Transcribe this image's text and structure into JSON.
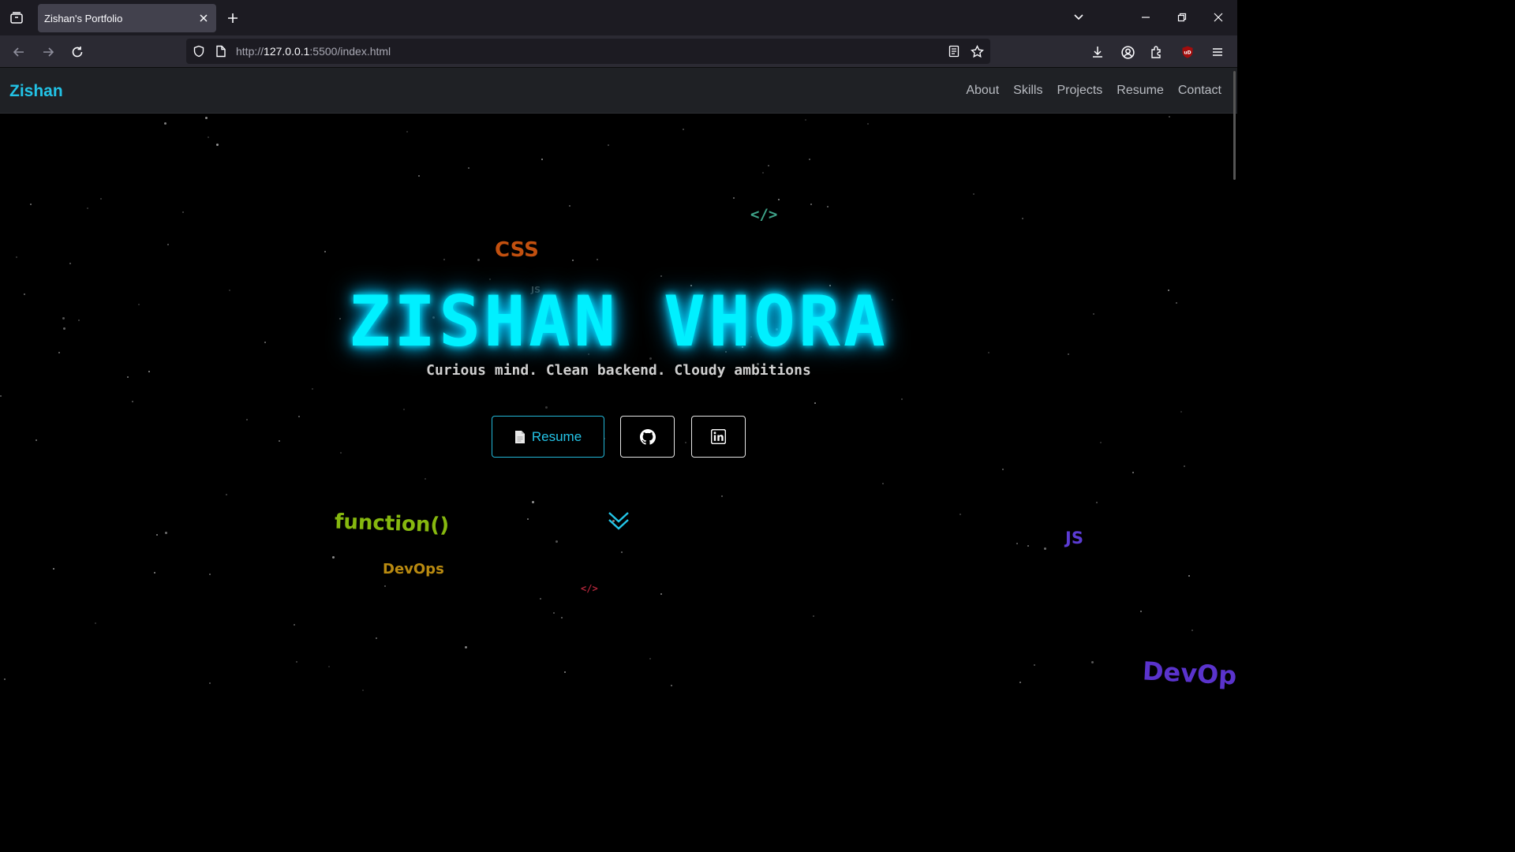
{
  "browser": {
    "tab_title": "Zishan's Portfolio",
    "url_prefix": "http://",
    "url_host": "127.0.0.1",
    "url_rest": ":5500/index.html"
  },
  "site": {
    "brand": "Zishan",
    "nav": [
      "About",
      "Skills",
      "Projects",
      "Resume",
      "Contact"
    ],
    "hero_title": "ZISHAN VHORA",
    "tagline": "Curious mind. Clean backend. Cloudy ambitions",
    "resume_button": "Resume",
    "floating_tags": [
      {
        "text": "</>",
        "color": "#3fa58b"
      },
      {
        "text": "CSS",
        "color": "#c2500f"
      },
      {
        "text": "JS",
        "color": "#3a3a3a"
      },
      {
        "text": "function()",
        "color": "#86b80f"
      },
      {
        "text": "DevOps",
        "color": "#b98a10"
      },
      {
        "text": "</>",
        "color": "#b0263a"
      },
      {
        "text": "JS",
        "color": "#5b3bd3"
      },
      {
        "text": "DevOps",
        "color": "#5a33cc"
      }
    ]
  },
  "colors": {
    "accent": "#22c3e6",
    "neon": "#00f0ff"
  }
}
